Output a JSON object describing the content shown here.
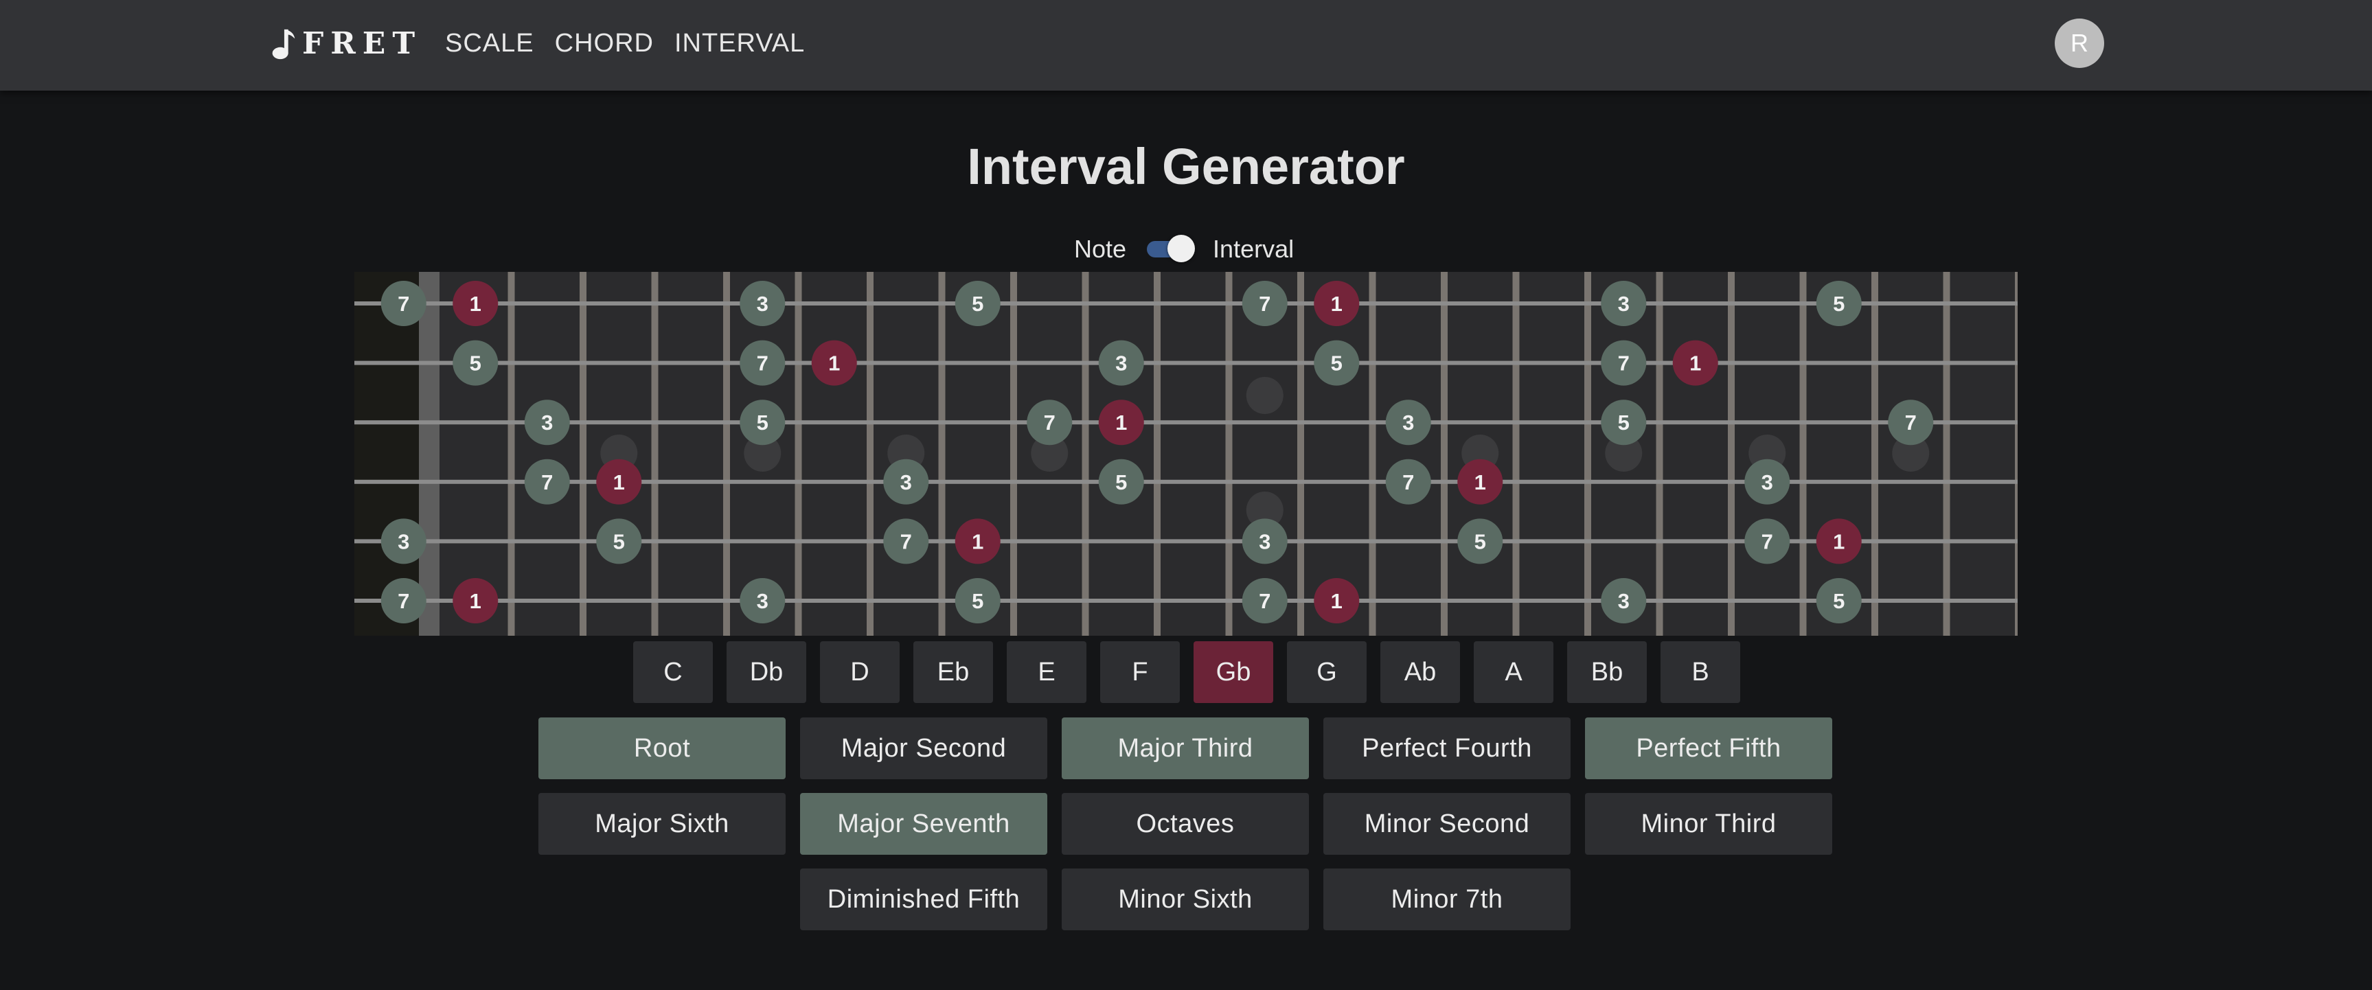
{
  "header": {
    "logo_text": "FRET",
    "nav": [
      "SCALE",
      "CHORD",
      "INTERVAL"
    ],
    "avatar_initial": "R"
  },
  "title": "Interval Generator",
  "toggle": {
    "left_label": "Note",
    "right_label": "Interval",
    "state": "Interval"
  },
  "colors": {
    "root": "#74243a",
    "interval": "#5a6b63",
    "selected_key": "#6b2337",
    "active_interval": "#5a6b63",
    "toggle_track": "#3a5b8f"
  },
  "fretboard": {
    "frets": 22,
    "strings": 6,
    "inlay_frets": [
      3,
      5,
      7,
      9,
      12,
      15,
      17,
      19,
      21
    ],
    "double_inlay_frets": [
      12
    ],
    "markers": [
      {
        "s": 1,
        "f": 0,
        "label": "7"
      },
      {
        "s": 1,
        "f": 1,
        "label": "1"
      },
      {
        "s": 1,
        "f": 5,
        "label": "3"
      },
      {
        "s": 1,
        "f": 8,
        "label": "5"
      },
      {
        "s": 1,
        "f": 12,
        "label": "7"
      },
      {
        "s": 1,
        "f": 13,
        "label": "1"
      },
      {
        "s": 1,
        "f": 17,
        "label": "3"
      },
      {
        "s": 1,
        "f": 20,
        "label": "5"
      },
      {
        "s": 2,
        "f": 1,
        "label": "5"
      },
      {
        "s": 2,
        "f": 5,
        "label": "7"
      },
      {
        "s": 2,
        "f": 6,
        "label": "1"
      },
      {
        "s": 2,
        "f": 10,
        "label": "3"
      },
      {
        "s": 2,
        "f": 13,
        "label": "5"
      },
      {
        "s": 2,
        "f": 17,
        "label": "7"
      },
      {
        "s": 2,
        "f": 18,
        "label": "1"
      },
      {
        "s": 3,
        "f": 2,
        "label": "3"
      },
      {
        "s": 3,
        "f": 5,
        "label": "5"
      },
      {
        "s": 3,
        "f": 9,
        "label": "7"
      },
      {
        "s": 3,
        "f": 10,
        "label": "1"
      },
      {
        "s": 3,
        "f": 14,
        "label": "3"
      },
      {
        "s": 3,
        "f": 17,
        "label": "5"
      },
      {
        "s": 3,
        "f": 21,
        "label": "7"
      },
      {
        "s": 4,
        "f": 2,
        "label": "7"
      },
      {
        "s": 4,
        "f": 3,
        "label": "1"
      },
      {
        "s": 4,
        "f": 7,
        "label": "3"
      },
      {
        "s": 4,
        "f": 10,
        "label": "5"
      },
      {
        "s": 4,
        "f": 14,
        "label": "7"
      },
      {
        "s": 4,
        "f": 15,
        "label": "1"
      },
      {
        "s": 4,
        "f": 19,
        "label": "3"
      },
      {
        "s": 5,
        "f": 0,
        "label": "3"
      },
      {
        "s": 5,
        "f": 3,
        "label": "5"
      },
      {
        "s": 5,
        "f": 7,
        "label": "7"
      },
      {
        "s": 5,
        "f": 8,
        "label": "1"
      },
      {
        "s": 5,
        "f": 12,
        "label": "3"
      },
      {
        "s": 5,
        "f": 15,
        "label": "5"
      },
      {
        "s": 5,
        "f": 19,
        "label": "7"
      },
      {
        "s": 5,
        "f": 20,
        "label": "1"
      },
      {
        "s": 6,
        "f": 0,
        "label": "7"
      },
      {
        "s": 6,
        "f": 1,
        "label": "1"
      },
      {
        "s": 6,
        "f": 5,
        "label": "3"
      },
      {
        "s": 6,
        "f": 8,
        "label": "5"
      },
      {
        "s": 6,
        "f": 12,
        "label": "7"
      },
      {
        "s": 6,
        "f": 13,
        "label": "1"
      },
      {
        "s": 6,
        "f": 17,
        "label": "3"
      },
      {
        "s": 6,
        "f": 20,
        "label": "5"
      }
    ]
  },
  "keys": {
    "items": [
      "C",
      "Db",
      "D",
      "Eb",
      "E",
      "F",
      "Gb",
      "G",
      "Ab",
      "A",
      "Bb",
      "B"
    ],
    "selected": "Gb"
  },
  "intervals": [
    {
      "label": "Root",
      "active": true
    },
    {
      "label": "Major Second",
      "active": false
    },
    {
      "label": "Major Third",
      "active": true
    },
    {
      "label": "Perfect Fourth",
      "active": false
    },
    {
      "label": "Perfect Fifth",
      "active": true
    },
    {
      "label": "Major Sixth",
      "active": false
    },
    {
      "label": "Major Seventh",
      "active": true
    },
    {
      "label": "Octaves",
      "active": false
    },
    {
      "label": "Minor Second",
      "active": false
    },
    {
      "label": "Minor Third",
      "active": false
    },
    {
      "label": "Diminished Fifth",
      "active": false
    },
    {
      "label": "Minor Sixth",
      "active": false
    },
    {
      "label": "Minor 7th",
      "active": false
    }
  ]
}
